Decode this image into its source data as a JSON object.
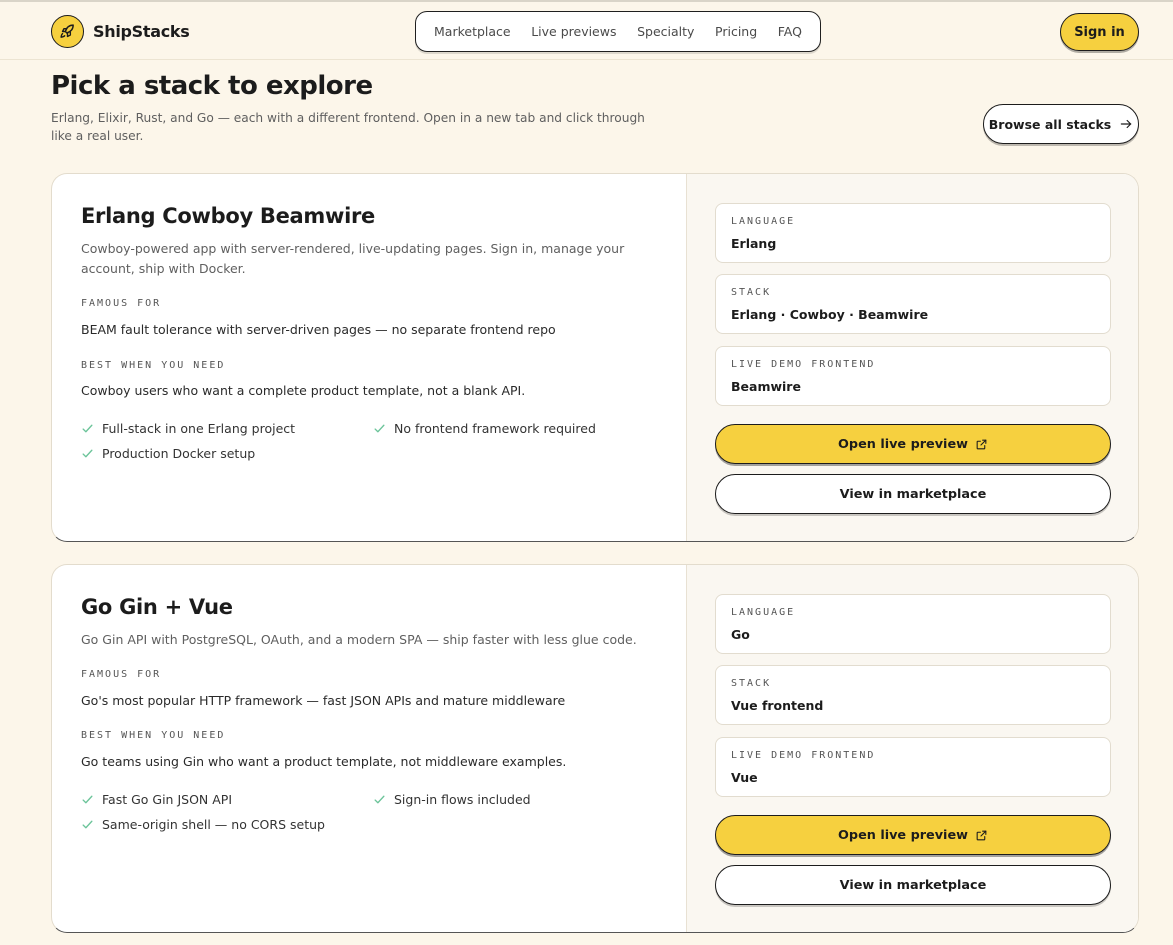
{
  "brand": {
    "name": "ShipStacks",
    "logo_icon": "rocket-icon"
  },
  "nav": {
    "items": [
      "Marketplace",
      "Live previews",
      "Specialty",
      "Pricing",
      "FAQ"
    ],
    "signin_label": "Sign in"
  },
  "page": {
    "title": "Pick a stack to explore",
    "subtitle": "Erlang, Elixir, Rust, and Go — each with a different frontend. Open in a new tab and click through like a real user.",
    "browse_label": "Browse all stacks"
  },
  "colors": {
    "accent": "#f6d03f",
    "background": "#fcf6ea",
    "check": "#6cc49a"
  },
  "labels": {
    "famous_for": "FAMOUS FOR",
    "best_when": "BEST WHEN YOU NEED",
    "language": "LANGUAGE",
    "stack": "STACK",
    "live_demo_frontend": "LIVE DEMO FRONTEND",
    "open_preview": "Open live preview",
    "view_marketplace": "View in marketplace"
  },
  "cards": [
    {
      "title": "Erlang Cowboy Beamwire",
      "description": "Cowboy-powered app with server-rendered, live-updating pages. Sign in, manage your account, ship with Docker.",
      "famous_for": "BEAM fault tolerance with server-driven pages — no separate frontend repo",
      "best_when": "Cowboy users who want a complete product template, not a blank API.",
      "features": [
        "Full-stack in one Erlang project",
        "No frontend framework required",
        "Production Docker setup"
      ],
      "language": "Erlang",
      "stack": "Erlang · Cowboy · Beamwire",
      "frontend": "Beamwire"
    },
    {
      "title": "Go Gin + Vue",
      "description": "Go Gin API with PostgreSQL, OAuth, and a modern SPA — ship faster with less glue code.",
      "famous_for": "Go's most popular HTTP framework — fast JSON APIs and mature middleware",
      "best_when": "Go teams using Gin who want a product template, not middleware examples.",
      "features": [
        "Fast Go Gin JSON API",
        "Sign-in flows included",
        "Same-origin shell — no CORS setup"
      ],
      "language": "Go",
      "stack": "Vue frontend",
      "frontend": "Vue"
    }
  ]
}
